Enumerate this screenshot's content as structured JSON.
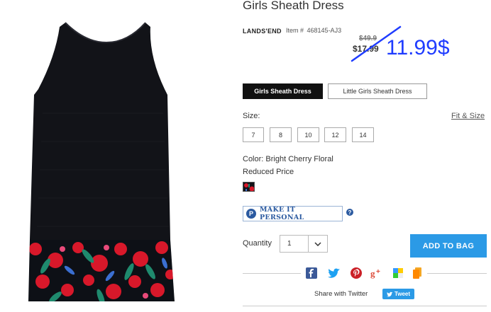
{
  "product": {
    "title": "Girls Sheath Dress",
    "brand": "LANDS'END",
    "item_label": "Item #",
    "item_number": "468145-AJ3",
    "original_price": "$49.9",
    "price": "$17.99",
    "new_price": "11.99$"
  },
  "styles": {
    "active": "Girls Sheath Dress",
    "inactive": "Little Girls Sheath Dress"
  },
  "size": {
    "label": "Size:",
    "fit_link": "Fit & Size",
    "options": [
      "7",
      "8",
      "10",
      "12",
      "14"
    ]
  },
  "color": {
    "label": "Color: Bright Cherry Floral",
    "reduced": "Reduced Price"
  },
  "personalize": {
    "label": "MAKE IT PERSONAL",
    "icon": "P"
  },
  "quantity": {
    "label": "Quantity",
    "value": "1"
  },
  "cart": {
    "add_label": "ADD TO BAG"
  },
  "share": {
    "text": "Share with Twitter",
    "tweet_label": "Tweet",
    "icons": [
      "facebook-icon",
      "twitter-icon",
      "pinterest-icon",
      "googleplus-icon",
      "delicious-icon",
      "blogger-icon"
    ]
  },
  "colors": {
    "accent_blue": "#2b9ae6",
    "personal_blue": "#2b5aa0",
    "annotation_blue": "#1f3cff",
    "facebook": "#3b5998",
    "twitter": "#1da1f2",
    "pinterest": "#cb2027",
    "googleplus": "#dd4b39"
  }
}
